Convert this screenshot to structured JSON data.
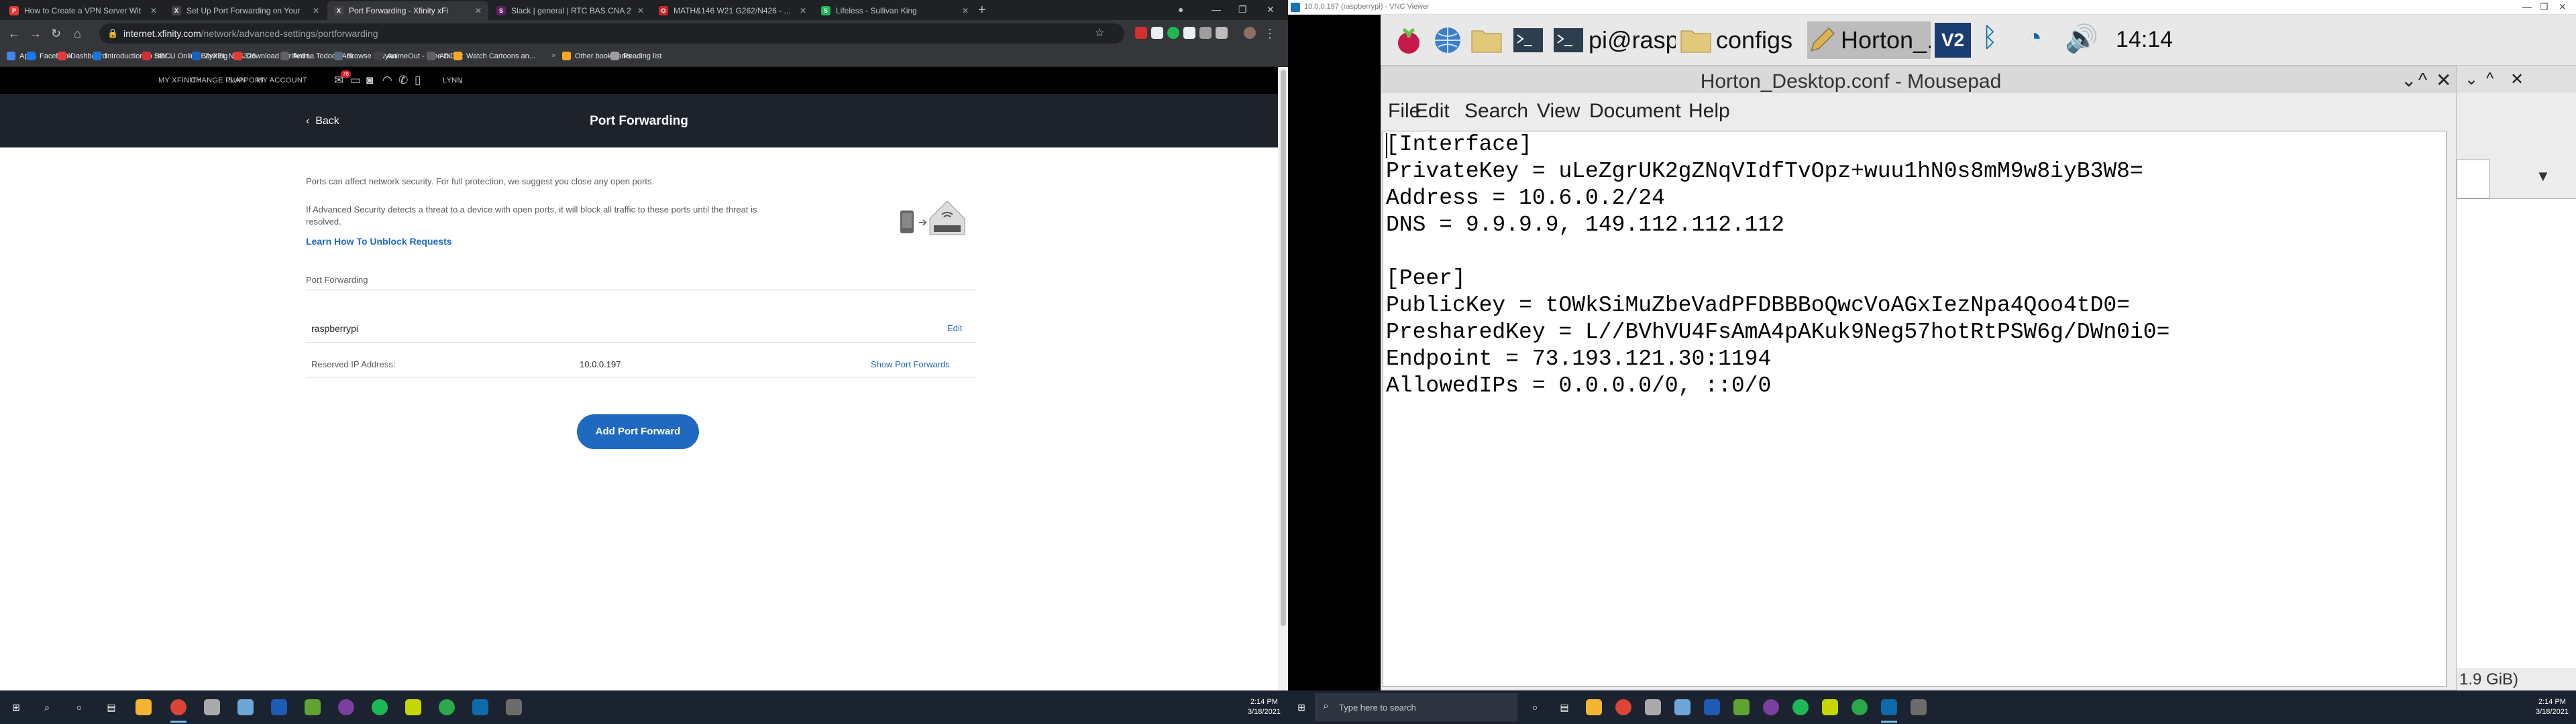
{
  "left": {
    "tabs": [
      {
        "title": "How to Create a VPN Server Wit",
        "color": "#e53935",
        "glyph": "P"
      },
      {
        "title": "Set Up Port Forwarding on Your",
        "color": "#444444",
        "glyph": "X"
      },
      {
        "title": "Port Forwarding - Xfinity xFi",
        "color": "#444444",
        "glyph": "X"
      },
      {
        "title": "Slack | general | RTC BAS CNA 2",
        "color": "#611f69",
        "glyph": "S"
      },
      {
        "title": "MATH&146 W21 G262/N426 - ...",
        "color": "#c62828",
        "glyph": "O"
      },
      {
        "title": "Lifeless - Sullivan King",
        "color": "#1db954",
        "glyph": "S"
      }
    ],
    "url_host": "internet.xfinity.com",
    "url_path": "/network/advanced-settings/portforwarding",
    "bookmarks": [
      {
        "label": "Apps",
        "color": "#4285f4"
      },
      {
        "label": "Facebook",
        "color": "#1877f2"
      },
      {
        "label": "Dashboard",
        "color": "#e53935"
      },
      {
        "label": "Introduction to Stat...",
        "color": "#1976d2"
      },
      {
        "label": "BECU Online Banking",
        "color": "#d32f2f"
      },
      {
        "label": "ZyXEL NAS326",
        "color": "#1565c0"
      },
      {
        "label": "Download verified t...",
        "color": "#e53935"
      },
      {
        "label": "Anime Todoo | Ani...",
        "color": "#616161"
      },
      {
        "label": "Browse :: Nyaa",
        "color": "#546e7a"
      },
      {
        "label": "AnimeOut - Free D...",
        "color": "#424242"
      },
      {
        "label": "AniDex",
        "color": "#616161"
      },
      {
        "label": "Watch Cartoons an...",
        "color": "#f9a825"
      }
    ],
    "other_bookmarks": "Other bookmarks",
    "reading_list": "Reading list",
    "nav": {
      "my_xfinity": "MY XFINITY",
      "change_plan": "CHANGE PLAN",
      "support": "SUPPORT",
      "my_account": "MY ACCOUNT",
      "badge": "78",
      "user": "LYNN"
    },
    "page": {
      "back": "Back",
      "title": "Port Forwarding",
      "intro": "Ports can affect network security. For full protection, we suggest you close any open ports.",
      "advanced_line1": "If Advanced Security detects a threat to a device with open ports, it will block all traffic to these ports until the threat is",
      "advanced_line2": "resolved.",
      "learn_link": "Learn How To Unblock Requests",
      "section_label": "Port Forwarding",
      "device_name": "raspberrypi",
      "edit": "Edit",
      "reserved_label": "Reserved IP Address:",
      "reserved_ip": "10.0.0.197",
      "show_forwards": "Show Port Forwards",
      "add_button": "Add Port Forward"
    },
    "clock_time": "2:14 PM",
    "clock_date": "3/18/2021"
  },
  "right": {
    "vnc_title": "10.0.0.197 (raspberrypi) - VNC Viewer",
    "panel": {
      "terminal_label": "pi@rasp...",
      "configs_label": "configs",
      "editor_label": "Horton_...",
      "time": "14:14"
    },
    "mousepad": {
      "title": "Horton_Desktop.conf - Mousepad",
      "menu": [
        "File",
        "Edit",
        "Search",
        "View",
        "Document",
        "Help"
      ],
      "lines": [
        "[Interface]",
        "PrivateKey = uLeZgrUK2gZNqVIdfTvOpz+wuu1hN0s8mM9w8iyB3W8=",
        "Address = 10.6.0.2/24",
        "DNS = 9.9.9.9, 149.112.112.112",
        "",
        "[Peer]",
        "PublicKey = tOWkSiMuZbeVadPFDBBBoQwcVoAGxIezNpa4Qoo4tD0=",
        "PresharedKey = L//BVhVU4FsAmA4pAKuk9Neg57hotRtPSW6g/DWn0i0=",
        "Endpoint = 73.193.121.30:1194",
        "AllowedIPs = 0.0.0.0/0, ::0/0"
      ]
    },
    "bg_status": "1.9 GiB)",
    "search_placeholder": "Type here to search",
    "clock_time": "2:14 PM",
    "clock_date": "3/18/2021"
  }
}
